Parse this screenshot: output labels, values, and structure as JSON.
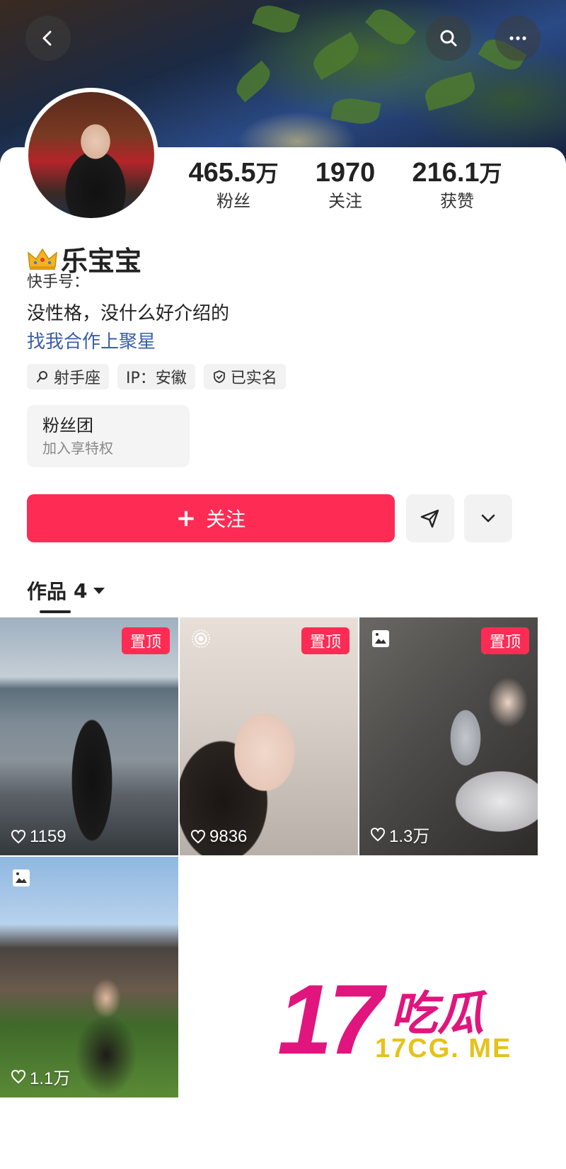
{
  "profile": {
    "name": "乐宝宝",
    "kuaishou_id_label": "快手号：",
    "bio": "没性格，没什么好介绍的",
    "bio_link": "找我合作上聚星"
  },
  "stats": [
    {
      "value": "465.5",
      "unit": "万",
      "label": "粉丝"
    },
    {
      "value": "1970",
      "unit": "",
      "label": "关注"
    },
    {
      "value": "216.1",
      "unit": "万",
      "label": "获赞"
    }
  ],
  "tags": [
    {
      "icon": "search-icon",
      "text": "射手座"
    },
    {
      "icon": "",
      "text": "IP：安徽"
    },
    {
      "icon": "shield-check-icon",
      "text": "已实名"
    }
  ],
  "fan_club": {
    "title": "粉丝团",
    "subtitle": "加入享特权"
  },
  "actions": {
    "follow_label": "关注",
    "follow_plus": "+"
  },
  "works_tab": {
    "label": "作品",
    "count": "4"
  },
  "works": [
    {
      "pinned": "置顶",
      "likes": "1159",
      "badge_icon": ""
    },
    {
      "pinned": "置顶",
      "likes": "9836",
      "badge_icon": "live-photo-icon"
    },
    {
      "pinned": "置顶",
      "likes": "1.3万",
      "badge_icon": "image-icon"
    },
    {
      "pinned": "",
      "likes": "1.1万",
      "badge_icon": "image-icon"
    }
  ],
  "watermark": {
    "number": "17",
    "chinese": "吃瓜",
    "domain": "17CG. ME"
  },
  "colors": {
    "accent": "#fe2c55",
    "link": "#3a5fa8",
    "watermark_pink": "#e0157d",
    "watermark_gold": "#e6c21a"
  }
}
